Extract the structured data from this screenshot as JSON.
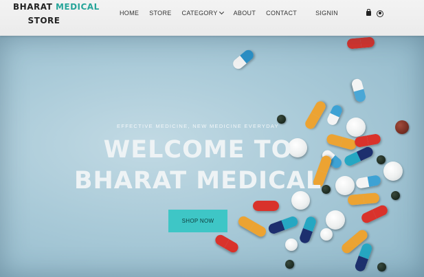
{
  "brand": {
    "line1_prefix": "BHARAT ",
    "line1_accent": "MEDICAL",
    "line2": "STORE",
    "accent_color": "#27a59a"
  },
  "nav": {
    "home": "HOME",
    "store": "STORE",
    "category": "CATEGORY",
    "about": "ABOUT",
    "contact": "CONTACT",
    "signin": "SIGNIN"
  },
  "icons": [
    "shopping-bag-icon",
    "user-icon"
  ],
  "hero": {
    "tagline": "EFFECTIVE MEDICINE, NEW MEDICINE EVERYDAY",
    "title_line1": "WELCOME TO",
    "title_line2": "BHARAT MEDICAL",
    "button": "SHOP NOW",
    "button_color": "#3ec6c6"
  }
}
